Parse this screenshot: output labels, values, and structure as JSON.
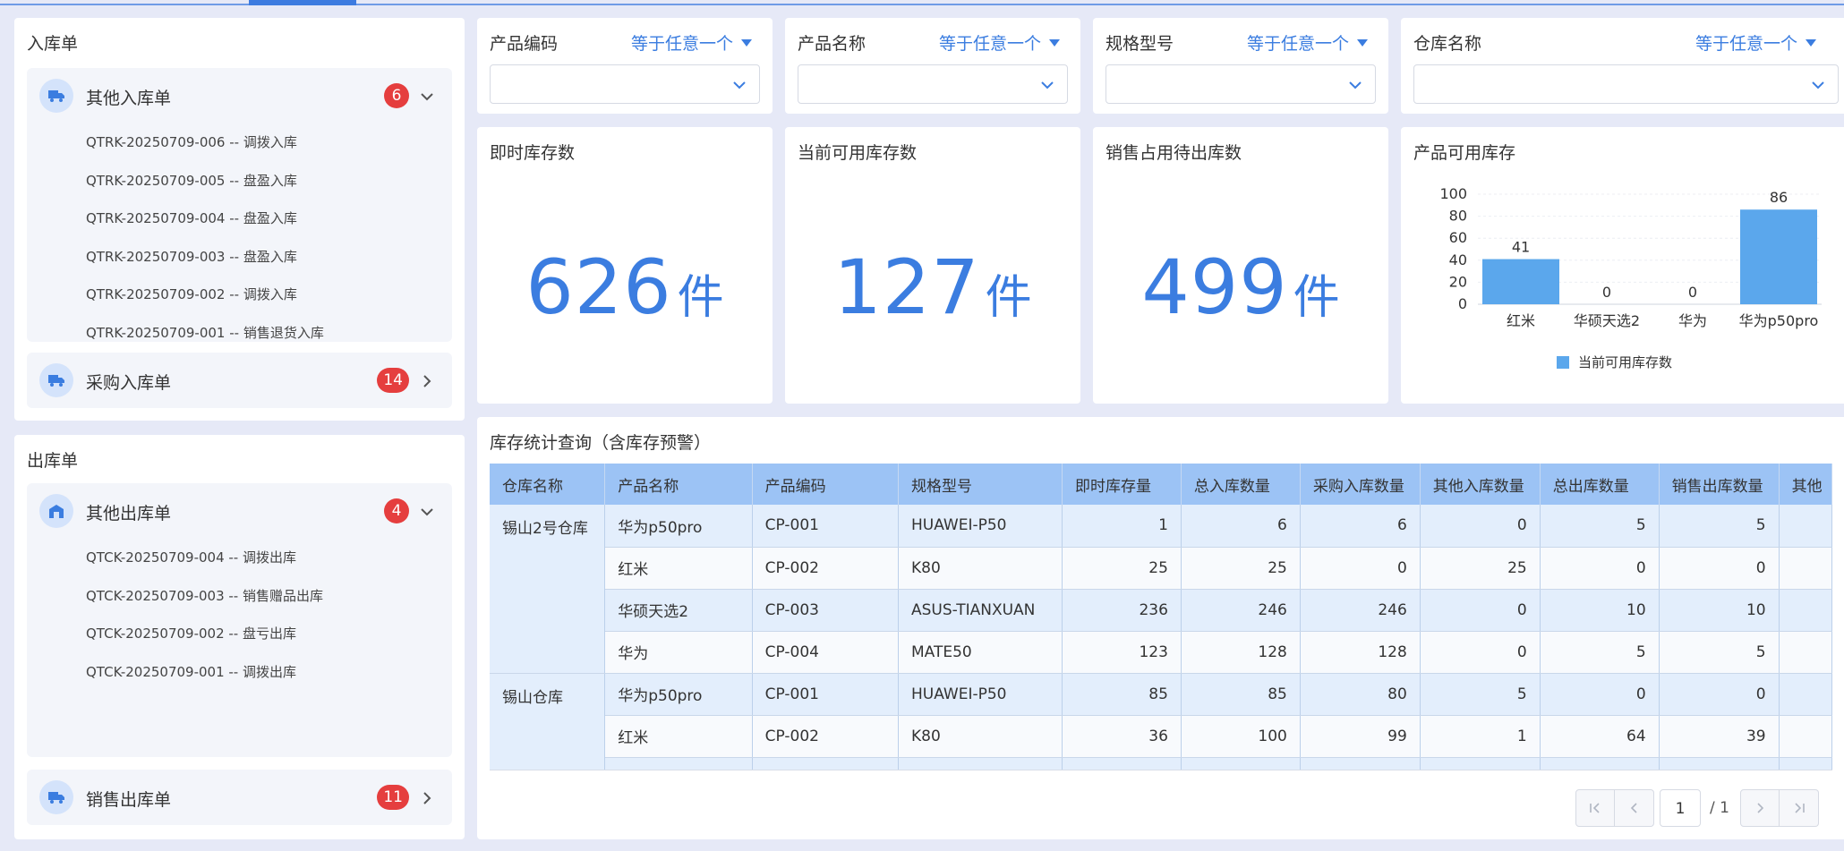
{
  "inbound": {
    "title": "入库单",
    "other": {
      "name": "其他入库单",
      "count": "6",
      "docs": [
        "QTRK-20250709-006 -- 调拨入库",
        "QTRK-20250709-005 -- 盘盈入库",
        "QTRK-20250709-004 -- 盘盈入库",
        "QTRK-20250709-003 -- 盘盈入库",
        "QTRK-20250709-002 -- 调拨入库",
        "QTRK-20250709-001 -- 销售退货入库"
      ]
    },
    "purchase": {
      "name": "采购入库单",
      "count": "14"
    }
  },
  "outbound": {
    "title": "出库单",
    "other": {
      "name": "其他出库单",
      "count": "4",
      "docs": [
        "QTCK-20250709-004 -- 调拨出库",
        "QTCK-20250709-003 -- 销售赠品出库",
        "QTCK-20250709-002 -- 盘亏出库",
        "QTCK-20250709-001 -- 调拨出库"
      ]
    },
    "sales": {
      "name": "销售出库单",
      "count": "11"
    }
  },
  "filters": [
    {
      "label": "产品编码",
      "op": "等于任意一个"
    },
    {
      "label": "产品名称",
      "op": "等于任意一个"
    },
    {
      "label": "规格型号",
      "op": "等于任意一个"
    },
    {
      "label": "仓库名称",
      "op": "等于任意一个"
    }
  ],
  "kpis": [
    {
      "title": "即时库存数",
      "value": "626",
      "unit": "件"
    },
    {
      "title": "当前可用库存数",
      "value": "127",
      "unit": "件"
    },
    {
      "title": "销售占用待出库数",
      "value": "499",
      "unit": "件"
    }
  ],
  "chart_title": "产品可用库存",
  "chart_data": {
    "type": "bar",
    "title": "产品可用库存",
    "categories": [
      "红米",
      "华硕天选2",
      "华为",
      "华为p50pro"
    ],
    "series": [
      {
        "name": "当前可用库存数",
        "values": [
          41,
          0,
          0,
          86
        ]
      }
    ],
    "ylim": [
      0,
      100
    ],
    "yticks": [
      0,
      20,
      40,
      60,
      80,
      100
    ],
    "legend": "bottom",
    "color": "#5ba7ec"
  },
  "table": {
    "title": "库存统计查询（含库存预警）",
    "columns": [
      "仓库名称",
      "产品名称",
      "产品编码",
      "规格型号",
      "即时库存量",
      "总入库数量",
      "采购入库数量",
      "其他入库数量",
      "总出库数量",
      "销售出库数量",
      "其他"
    ],
    "groups": [
      {
        "warehouse": "锡山2号仓库",
        "rows": [
          [
            "华为p50pro",
            "CP-001",
            "HUAWEI-P50",
            "1",
            "6",
            "6",
            "0",
            "5",
            "5"
          ],
          [
            "红米",
            "CP-002",
            "K80",
            "25",
            "25",
            "0",
            "25",
            "0",
            "0"
          ],
          [
            "华硕天选2",
            "CP-003",
            "ASUS-TIANXUAN",
            "236",
            "246",
            "246",
            "0",
            "10",
            "10"
          ],
          [
            "华为",
            "CP-004",
            "MATE50",
            "123",
            "128",
            "128",
            "0",
            "5",
            "5"
          ]
        ]
      },
      {
        "warehouse": "锡山仓库",
        "rows": [
          [
            "华为p50pro",
            "CP-001",
            "HUAWEI-P50",
            "85",
            "85",
            "80",
            "5",
            "0",
            "0"
          ],
          [
            "红米",
            "CP-002",
            "K80",
            "36",
            "100",
            "99",
            "1",
            "64",
            "39"
          ],
          [
            "",
            "",
            "",
            "",
            "",
            "",
            "",
            "",
            ""
          ]
        ]
      }
    ],
    "pager": {
      "page": "1",
      "total": "/ 1"
    }
  }
}
